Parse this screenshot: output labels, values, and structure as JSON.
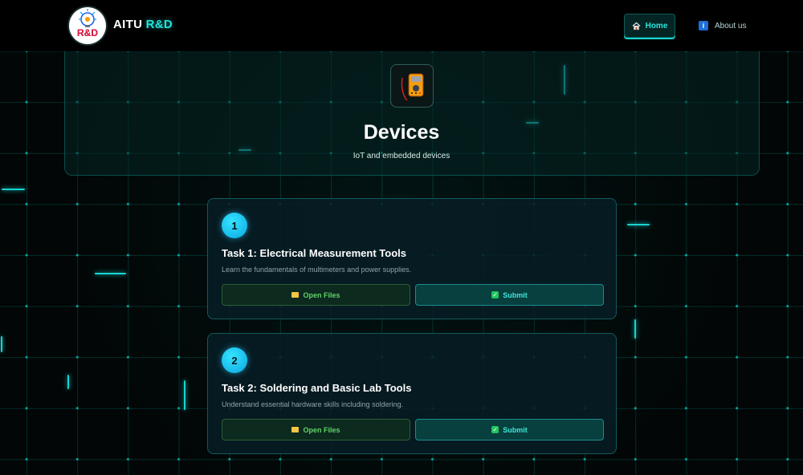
{
  "header": {
    "brand_prefix": "AITU",
    "brand_accent": "R&D",
    "logo_lettering": "R&D",
    "nav": {
      "home_label": "Home",
      "about_label": "About us"
    }
  },
  "hero": {
    "title": "Devices",
    "subtitle": "IoT and embedded devices",
    "icon": "multimeter-icon"
  },
  "tasks": [
    {
      "number": "1",
      "title": "Task 1: Electrical Measurement Tools",
      "description": "Learn the fundamentals of multimeters and power supplies.",
      "open_label": "Open Files",
      "submit_label": "Submit"
    },
    {
      "number": "2",
      "title": "Task 2: Soldering and Basic Lab Tools",
      "description": "Understand essential hardware skills including soldering.",
      "open_label": "Open Files",
      "submit_label": "Submit"
    }
  ],
  "colors": {
    "accent": "#22e3dc",
    "background": "#020606",
    "badge": "#1cc7f0",
    "open_button_text": "#5fd36a",
    "submit_button_text": "#3ee6d8"
  }
}
